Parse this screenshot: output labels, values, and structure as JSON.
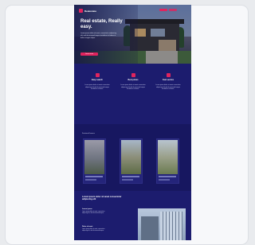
{
  "site": {
    "logo_text": "Realestate",
    "nav": [
      "Sign in",
      "Sign up"
    ],
    "hero": {
      "title": "Real estate, Really easy.",
      "text": "Lorem ipsum dolor sit amet, consectetur adipiscing elit, sed do eiusmod tempor incididunt ut labore et dolore magna aliqua.",
      "button": "Learn more"
    },
    "features": [
      {
        "title": "Easy search",
        "text": "Lorem ipsum dolor sit amet consectetur adipiscing elit sed do eiusmod tempor incididunt ut labore."
      },
      {
        "title": "Best prices",
        "text": "Lorem ipsum dolor sit amet consectetur adipiscing elit sed do eiusmod tempor incididunt ut labore."
      },
      {
        "title": "Fast service",
        "text": "Lorem ipsum dolor sit amet consectetur adipiscing elit sed do eiusmod tempor incididunt ut labore."
      }
    ],
    "listings": {
      "label": "Featured homes"
    },
    "about": {
      "heading": "Lorem ipsum dolor sit amet consectetur adipiscing elit",
      "sub1": "Lorem ipsum",
      "sub2": "Dolor sit amet",
      "text": "Lorem ipsum dolor sit amet, consectetur adipiscing elit, sed do eiusmod tempor."
    }
  },
  "colors": {
    "accent": "#e0245e",
    "background": "#1c1c6e"
  }
}
